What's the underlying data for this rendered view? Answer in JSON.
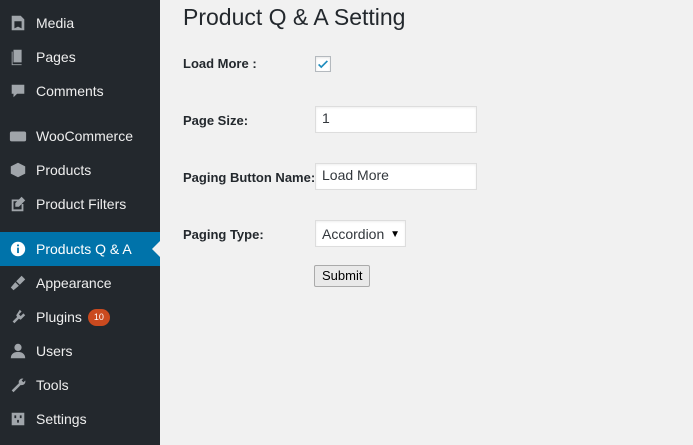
{
  "sidebar": {
    "items": [
      {
        "label": "Media",
        "icon": "media-icon",
        "active": false
      },
      {
        "label": "Pages",
        "icon": "pages-icon",
        "active": false
      },
      {
        "label": "Comments",
        "icon": "comments-icon",
        "active": false
      },
      {
        "label": "WooCommerce",
        "icon": "woocommerce-icon",
        "active": false
      },
      {
        "label": "Products",
        "icon": "products-icon",
        "active": false
      },
      {
        "label": "Product Filters",
        "icon": "edit-icon",
        "active": false
      },
      {
        "label": "Products Q & A",
        "icon": "info-icon",
        "active": true
      },
      {
        "label": "Appearance",
        "icon": "appearance-icon",
        "active": false
      },
      {
        "label": "Plugins",
        "icon": "plugins-icon",
        "active": false,
        "badge": "10"
      },
      {
        "label": "Users",
        "icon": "users-icon",
        "active": false
      },
      {
        "label": "Tools",
        "icon": "tools-icon",
        "active": false
      },
      {
        "label": "Settings",
        "icon": "settings-icon",
        "active": false
      }
    ]
  },
  "main": {
    "title": "Product Q & A Setting",
    "form": {
      "load_more_label": "Load More :",
      "load_more_checked": true,
      "page_size_label": "Page Size:",
      "page_size_value": "1",
      "paging_button_name_label": "Paging Button Name:",
      "paging_button_name_value": "Load More",
      "paging_type_label": "Paging Type:",
      "paging_type_value": "Accordion",
      "submit_label": "Submit"
    }
  },
  "colors": {
    "sidebar_bg": "#23282d",
    "active_bg": "#0073aa",
    "badge_bg": "#ca4a1f",
    "page_bg": "#f1f1f1",
    "checkmark": "#1e8cbe"
  }
}
